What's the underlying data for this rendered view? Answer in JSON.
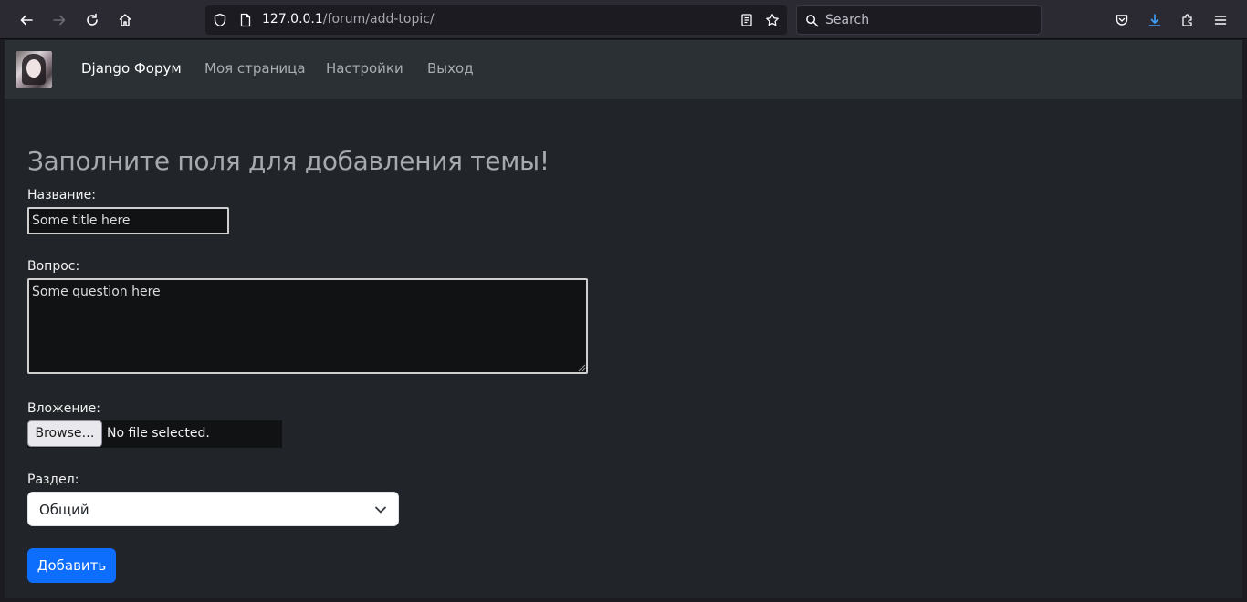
{
  "browser": {
    "url_host": "127.0.0.1",
    "url_path": "/forum/add-topic/",
    "search_placeholder": "Search"
  },
  "nav": {
    "brand": "Django Форум",
    "links": [
      "Моя страница",
      "Настройки",
      "Выход"
    ]
  },
  "form": {
    "heading": "Заполните поля для добавления темы!",
    "title_label": "Название:",
    "title_value": "Some title here",
    "question_label": "Вопрос:",
    "question_value": "Some question here",
    "attachment_label": "Вложение:",
    "browse_label": "Browse…",
    "file_status": "No file selected.",
    "section_label": "Раздел:",
    "section_selected": "Общий",
    "submit_label": "Добавить"
  },
  "colors": {
    "accent": "#0d6efd",
    "navbar_bg": "#2b3035",
    "page_bg": "#212529"
  },
  "icons": {
    "back": "arrow-left-icon",
    "forward": "arrow-right-icon",
    "reload": "reload-icon",
    "home": "home-icon",
    "shield": "shield-icon",
    "page": "page-icon",
    "reader": "reader-view-icon",
    "bookmark": "star-icon",
    "search": "search-icon",
    "pocket": "pocket-icon",
    "downloads": "download-icon",
    "extensions": "puzzle-icon",
    "menu": "hamburger-menu-icon",
    "select_arrow": "chevron-down-icon"
  }
}
